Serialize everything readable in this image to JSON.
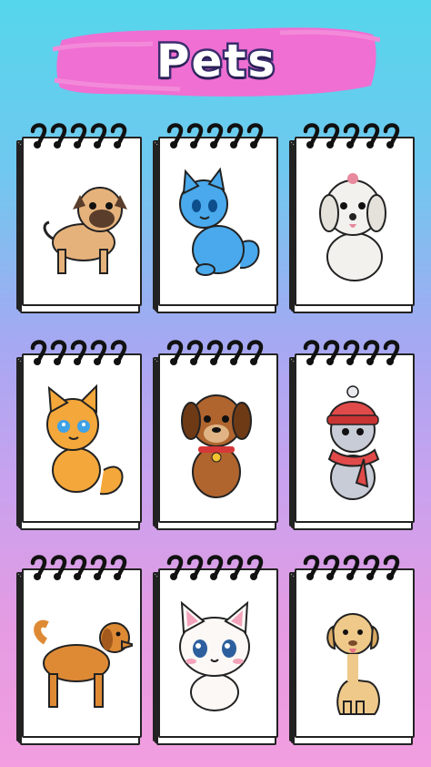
{
  "title": "Pets",
  "colors": {
    "banner": "#f06fd2",
    "title_stroke": "#3a2c6e"
  },
  "items": [
    {
      "name": "pug",
      "icon": "pug-dog-icon",
      "fur": "#e6b27c",
      "accent": "#5a3d2a"
    },
    {
      "name": "blue-cat",
      "icon": "blue-cat-icon",
      "fur": "#49a9ec",
      "accent": "#2d6fb0"
    },
    {
      "name": "white-dog",
      "icon": "white-maltese-dog-icon",
      "fur": "#f2f1ee",
      "accent": "#e8899d"
    },
    {
      "name": "orange-kitten",
      "icon": "orange-kitten-icon",
      "fur": "#f4a73a",
      "accent": "#3fa2e6"
    },
    {
      "name": "brown-puppy",
      "icon": "brown-puppy-icon",
      "fur": "#b0652f",
      "accent": "#d73738"
    },
    {
      "name": "hat-cat",
      "icon": "cat-with-hat-icon",
      "fur": "#c8ccd6",
      "accent": "#e14a4a"
    },
    {
      "name": "golden-retriever",
      "icon": "golden-retriever-icon",
      "fur": "#de8a35",
      "accent": "#a55a1d"
    },
    {
      "name": "white-kitten",
      "icon": "white-kitten-icon",
      "fur": "#fbf8f6",
      "accent": "#f3a4bb"
    },
    {
      "name": "labrador",
      "icon": "labrador-dog-icon",
      "fur": "#efc98a",
      "accent": "#7a4a2a"
    }
  ]
}
